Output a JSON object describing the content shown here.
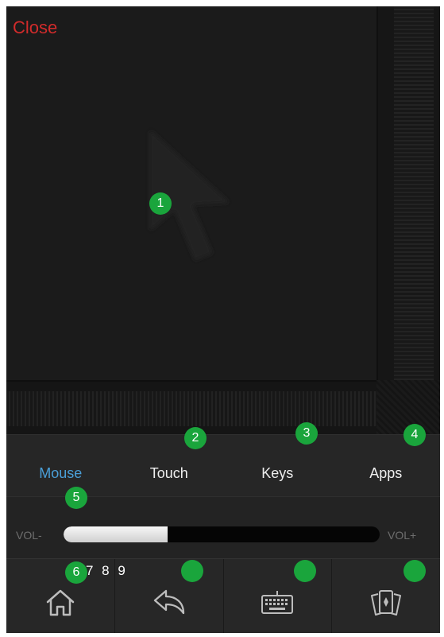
{
  "close_label": "Close",
  "tabs": [
    {
      "label": "Mouse",
      "active": true
    },
    {
      "label": "Touch",
      "active": false
    },
    {
      "label": "Keys",
      "active": false
    },
    {
      "label": "Apps",
      "active": false
    }
  ],
  "volume": {
    "minus_label": "VOL-",
    "plus_label": "VOL+",
    "level": 0.33
  },
  "nav_buttons": [
    {
      "icon": "home-icon"
    },
    {
      "icon": "back-arrow-icon"
    },
    {
      "icon": "keyboard-icon"
    },
    {
      "icon": "cards-icon"
    }
  ],
  "markers": {
    "m1": "1",
    "m2": "2",
    "m3": "3",
    "m4": "4",
    "m5": "5",
    "m6": "6",
    "m7": "",
    "m8": "",
    "m9": "",
    "extra_digits": "7 8 9"
  },
  "colors": {
    "close": "#d12b2b",
    "active_tab": "#4a9fd8",
    "marker": "#1aa53c"
  }
}
